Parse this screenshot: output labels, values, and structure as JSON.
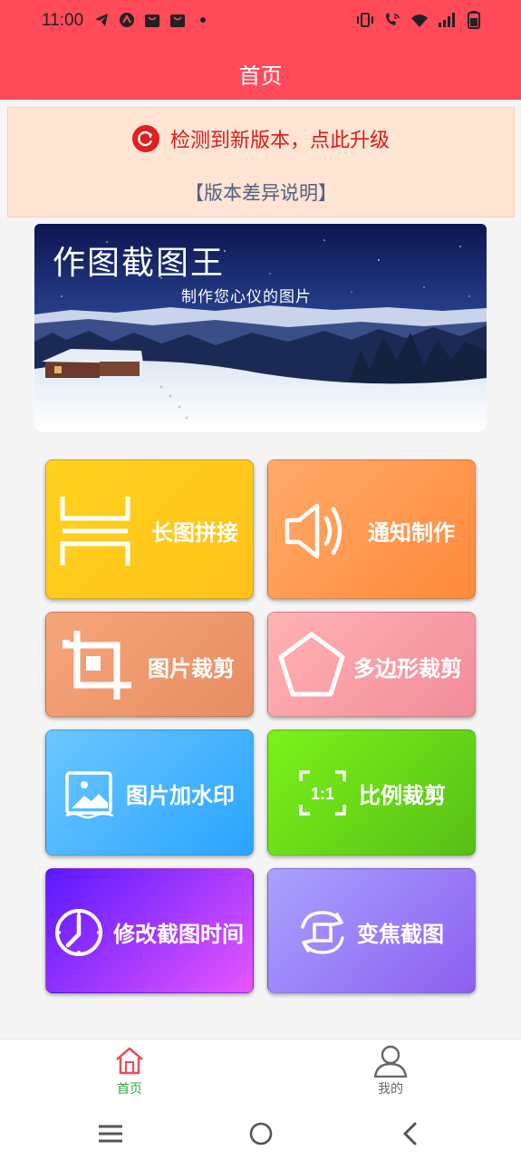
{
  "status_bar": {
    "time": "11:00",
    "left_icons": [
      "telegram-icon",
      "app-icon",
      "shop-icon",
      "shop-icon",
      "dot-icon"
    ],
    "right_icons": [
      "vibrate-icon",
      "wifi-call-icon",
      "wifi-icon",
      "signal-icon",
      "battery-icon"
    ]
  },
  "header": {
    "title": "首页"
  },
  "update_banner": {
    "message": "检测到新版本，点此升级",
    "diff_link": "【版本差异说明】"
  },
  "banner": {
    "title": "作图截图王",
    "subtitle": "制作您心仪的图片"
  },
  "tiles": [
    {
      "label": "长图拼接",
      "icon": "long-image-stitch-icon",
      "colors": [
        "#ffd21f",
        "#ffc21a"
      ]
    },
    {
      "label": "通知制作",
      "icon": "speaker-icon",
      "colors": [
        "#ffaa6a",
        "#ff8a3a"
      ]
    },
    {
      "label": "图片裁剪",
      "icon": "crop-icon",
      "colors": [
        "#f6a57a",
        "#e88d64"
      ]
    },
    {
      "label": "多边形裁剪",
      "icon": "pentagon-icon",
      "colors": [
        "#ffb3b3",
        "#f28c9a"
      ]
    },
    {
      "label": "图片加水印",
      "icon": "image-watermark-icon",
      "colors": [
        "#6cc7ff",
        "#2aa4ff"
      ]
    },
    {
      "label": "比例裁剪",
      "icon": "ratio-1-1-icon",
      "colors": [
        "#7cf21a",
        "#57bf17"
      ]
    },
    {
      "label": "修改截图时间",
      "icon": "clock-icon",
      "colors": [
        "#5a18ff",
        "#e657ff"
      ]
    },
    {
      "label": "变焦截图",
      "icon": "zoom-rotate-icon",
      "colors": [
        "#a9a2ff",
        "#8c5ff1"
      ]
    }
  ],
  "bottom_nav": {
    "items": [
      {
        "label": "首页",
        "icon": "home-icon",
        "active": true,
        "color": "#3aa345"
      },
      {
        "label": "我的",
        "icon": "user-icon",
        "active": false,
        "color": "#666666"
      }
    ]
  },
  "system_nav": [
    "menu-icon",
    "home-circle-icon",
    "back-icon"
  ]
}
